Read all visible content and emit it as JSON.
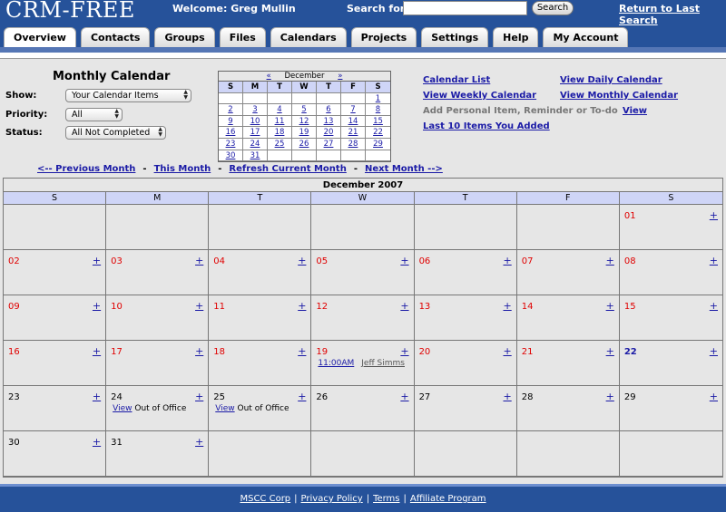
{
  "app": {
    "logo": "CRM-FREE",
    "welcome": "Welcome: Greg Mullin",
    "search_label": "Search for:",
    "search_value": "",
    "search_button": "Search",
    "return_link": "Return to Last Search"
  },
  "tabs": [
    "Overview",
    "Contacts",
    "Groups",
    "Files",
    "Calendars",
    "Projects",
    "Settings",
    "Help",
    "My Account"
  ],
  "active_tab": "Overview",
  "panel": {
    "title": "Monthly Calendar",
    "show_label": "Show:",
    "show_value": "Your Calendar Items",
    "priority_label": "Priority:",
    "priority_value": "All",
    "status_label": "Status:",
    "status_value": "All Not Completed"
  },
  "mini_calendar": {
    "prev": "«",
    "month": "December",
    "next": "»",
    "days_of_week": [
      "S",
      "M",
      "T",
      "W",
      "T",
      "F",
      "S"
    ],
    "cells": [
      "",
      "",
      "",
      "",
      "",
      "",
      "1",
      "2",
      "3",
      "4",
      "5",
      "6",
      "7",
      "8",
      "9",
      "10",
      "11",
      "12",
      "13",
      "14",
      "15",
      "16",
      "17",
      "18",
      "19",
      "20",
      "21",
      "22",
      "23",
      "24",
      "25",
      "26",
      "27",
      "28",
      "29",
      "30",
      "31",
      "",
      "",
      "",
      "",
      ""
    ]
  },
  "links": {
    "calendar_list": "Calendar List",
    "view_daily": "View Daily Calendar",
    "view_weekly": "View Weekly Calendar",
    "view_monthly": "View Monthly Calendar",
    "add_item": "Add Personal Item, Reminder or To-do",
    "view": "View",
    "last_10": "Last 10 Items You Added"
  },
  "nav": {
    "prev": "<-- Previous Month",
    "sep": "-",
    "this_month": "This Month",
    "refresh": "Refresh Current Month",
    "next": "Next Month -->"
  },
  "big_calendar": {
    "title": "December 2007",
    "days_of_week": [
      "S",
      "M",
      "T",
      "W",
      "T",
      "F",
      "S"
    ],
    "plus": "+",
    "event_view": "View",
    "event_text": "Out of Office",
    "event_time": "11:00AM",
    "event_person": "Jeff Simms"
  },
  "footer": {
    "links": [
      "MSCC Corp",
      "Privacy Policy",
      "Terms",
      "Affiliate Program"
    ],
    "pipe": "|"
  },
  "colors": {
    "header_blue": "#26529a",
    "day_header": "#cfd5f7",
    "weekend_red": "#e00000",
    "link_blue": "#1a1aa6",
    "cell_grey": "#e6e6e6"
  }
}
